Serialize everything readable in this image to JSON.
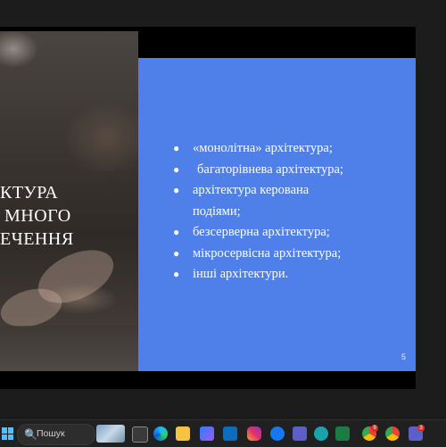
{
  "slide": {
    "title_lines": [
      "КТУРА",
      "МНОГО",
      "ЕЧЕННЯ"
    ],
    "bullets": [
      "«монолітна» архітектура;",
      "багаторівнева архітектура;",
      "архітектура керована",
      "подіями;",
      "безсерверна архітектура;",
      "мікросервісна архітектура;",
      "інші архітектури."
    ],
    "bullet_marker": "●",
    "slide_number": "5",
    "colors": {
      "accent_panel": "#4f7fe8",
      "background": "#000000"
    }
  },
  "taskbar": {
    "search_icon": "🔍",
    "search_placeholder": "Пошук",
    "icons": [
      "windows-start-icon",
      "search-icon",
      "widget-thumbnail",
      "task-view-icon",
      "edge-icon",
      "file-explorer-icon",
      "photos-icon",
      "outlook-icon",
      "instagram-icon",
      "facebook-icon",
      "teams-icon",
      "picsart-icon",
      "excel-icon",
      "chrome-icon",
      "chrome-profile-icon",
      "teams-chat-icon"
    ],
    "badges": {
      "chrome": "9",
      "chat": "3"
    }
  }
}
